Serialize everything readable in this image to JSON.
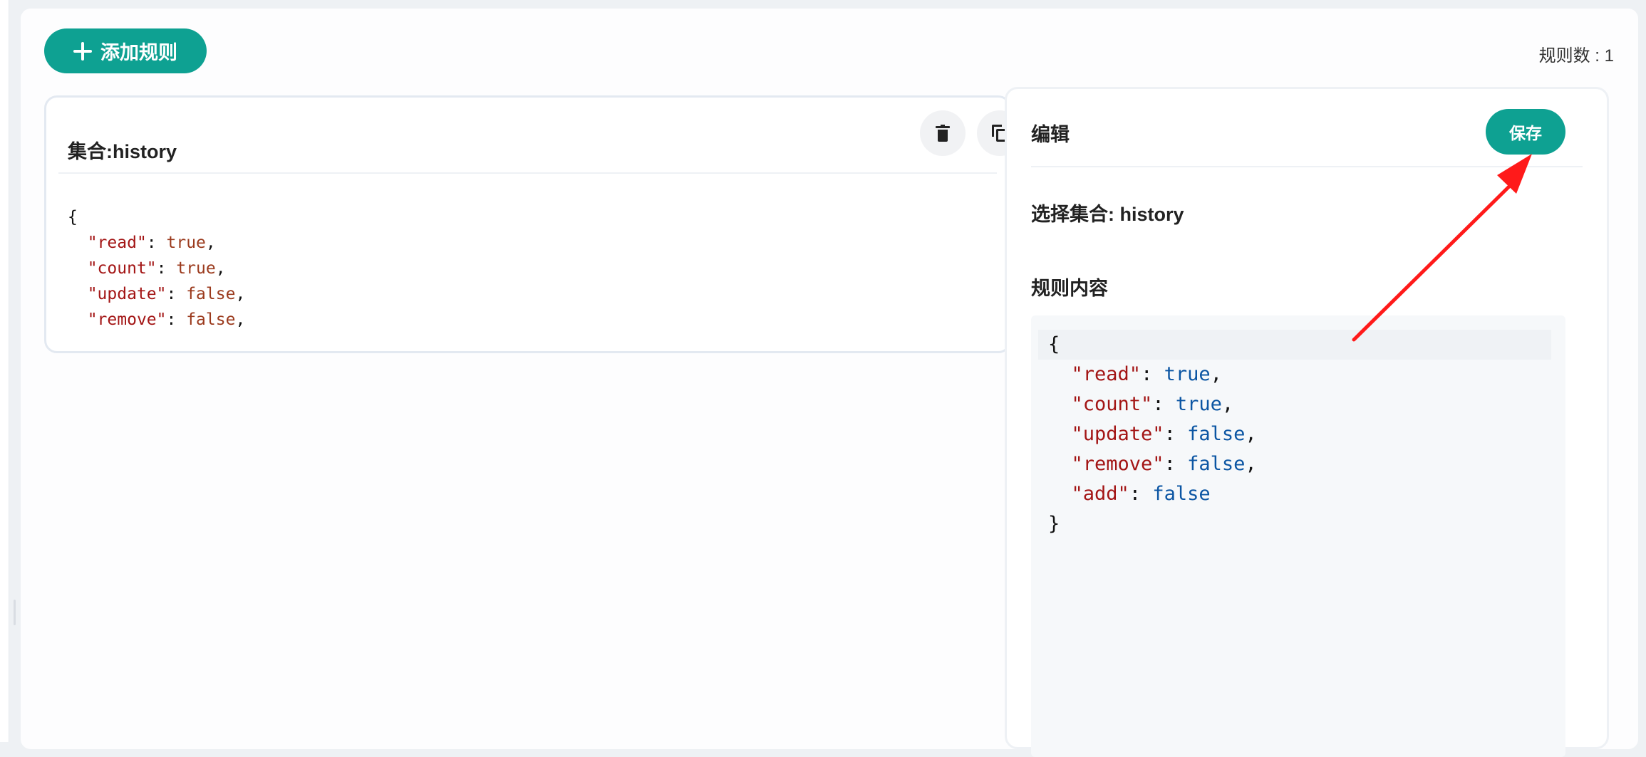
{
  "toolbar": {
    "add_label": "添加规则",
    "rule_count": "规则数 : 1"
  },
  "rule_card": {
    "title": "集合:history",
    "code_lines": [
      {
        "open": "{"
      },
      {
        "key": "\"read\"",
        "value": "true",
        "tail": ","
      },
      {
        "key": "\"count\"",
        "value": "true",
        "tail": ","
      },
      {
        "key": "\"update\"",
        "value": "false",
        "tail": ","
      },
      {
        "key": "\"remove\"",
        "value": "false",
        "tail": ","
      }
    ]
  },
  "edit_panel": {
    "title": "编辑",
    "save_label": "保存",
    "select_label": "选择集合: history",
    "content_label": "规则内容",
    "code_lines": [
      {
        "open": "{"
      },
      {
        "key": "\"read\"",
        "value": "true",
        "tail": ","
      },
      {
        "key": "\"count\"",
        "value": "true",
        "tail": ","
      },
      {
        "key": "\"update\"",
        "value": "false",
        "tail": ","
      },
      {
        "key": "\"remove\"",
        "value": "false",
        "tail": ","
      },
      {
        "key": "\"add\"",
        "value": "false",
        "tail": ""
      },
      {
        "open": "}"
      }
    ]
  },
  "colors": {
    "accent": "#0ea192",
    "arrow": "#ff1a1a",
    "json_key": "#a31515",
    "json_value": "#0b55a3"
  },
  "icons": [
    "plus-icon",
    "trash-icon",
    "copy-icon"
  ]
}
